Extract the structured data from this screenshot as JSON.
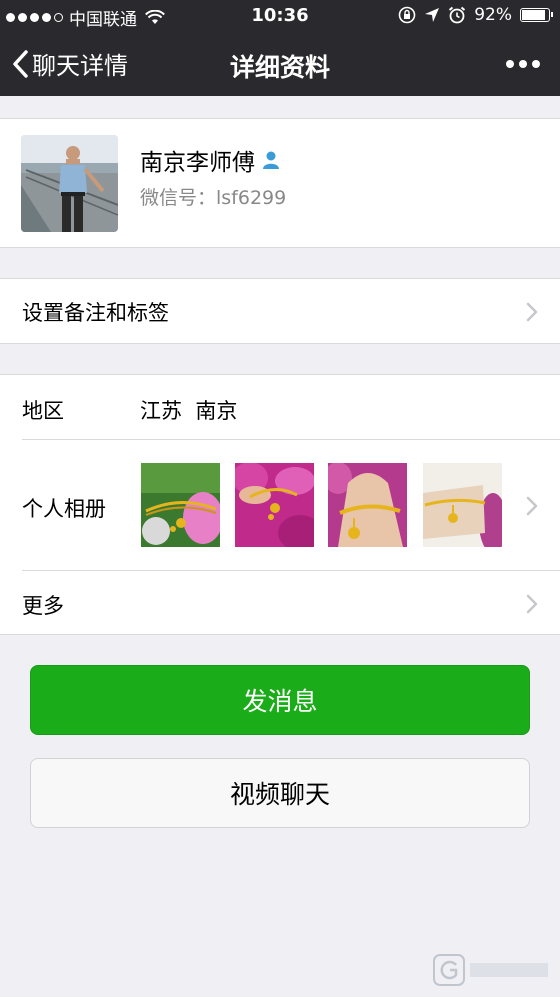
{
  "status_bar": {
    "carrier": "中国联通",
    "time": "10:36",
    "battery": "92%",
    "battery_level": 0.92
  },
  "nav": {
    "back_label": "聊天详情",
    "title": "详细资料"
  },
  "profile": {
    "name": "南京李师傅",
    "wechat_id": "微信号：lsf6299"
  },
  "remark_row": {
    "label": "设置备注和标签"
  },
  "region": {
    "label": "地区",
    "value": "江苏  南京"
  },
  "album": {
    "label": "个人相册",
    "photos": [
      "bracelet-photo-1",
      "bracelet-photo-2",
      "bracelet-photo-3",
      "bracelet-photo-4"
    ]
  },
  "more_row": {
    "label": "更多"
  },
  "buttons": {
    "send_message": "发消息",
    "video_call": "视频聊天"
  },
  "colors": {
    "nav_bg": "#2a2a2e",
    "primary_green": "#1aad19",
    "page_bg": "#efeff4",
    "contact_icon": "#3a9bd9"
  }
}
